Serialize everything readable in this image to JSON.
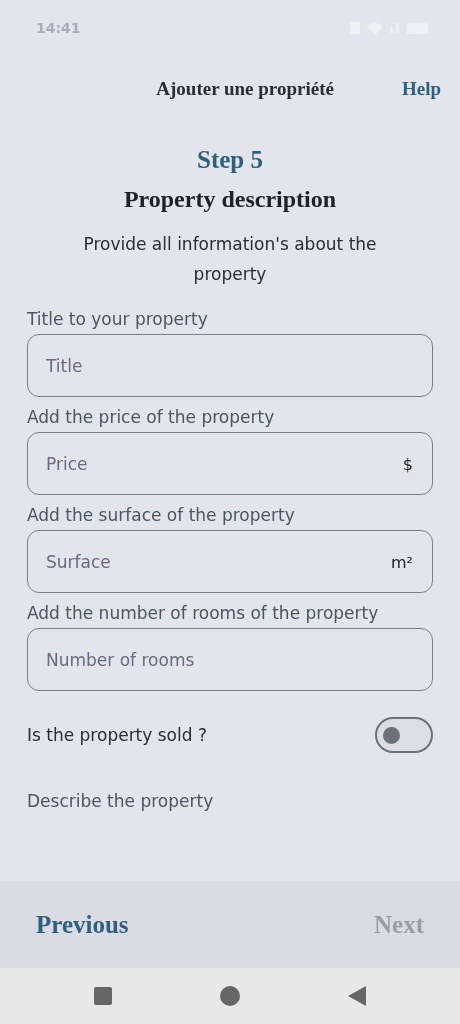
{
  "status_bar": {
    "time": "14:41"
  },
  "header": {
    "title": "Ajouter une propriété",
    "help": "Help"
  },
  "step": {
    "label": "Step 5",
    "title": "Property description",
    "description": "Provide all information's about the property"
  },
  "fields": [
    {
      "label": "Title to your property",
      "placeholder": "Title"
    },
    {
      "label": "Add the price of the property",
      "placeholder": "Price",
      "suffix": "$"
    },
    {
      "label": "Add the surface of the property",
      "placeholder": "Surface",
      "suffix": "m²"
    },
    {
      "label": "Add the number of rooms of the property",
      "placeholder": "Number of rooms"
    }
  ],
  "sold_switch": {
    "label": "Is the property sold ?",
    "on": false
  },
  "description_label": "Describe the property",
  "footer": {
    "previous": {
      "label": "Previous",
      "disabled": false
    },
    "next": {
      "label": "Next",
      "disabled": true
    }
  }
}
